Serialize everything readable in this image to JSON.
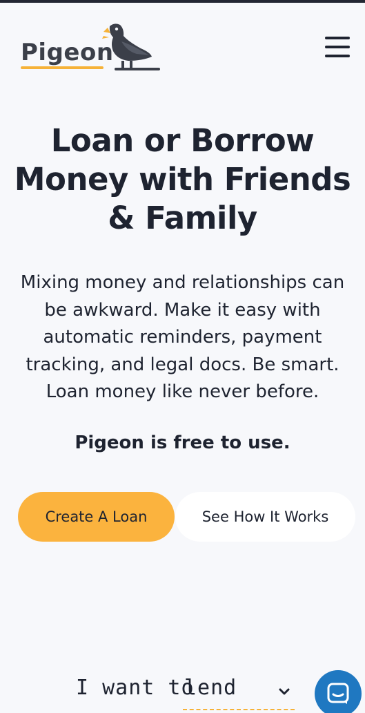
{
  "header": {
    "logo_text": "Pigeon",
    "brand_color": "#f6b238",
    "menu_icon": "hamburger-menu-icon"
  },
  "hero": {
    "title_lines": [
      "Loan or Borrow",
      "Money with Friends",
      "& Family"
    ],
    "description_lines": [
      "Mixing money and relationships can",
      "be awkward. Make it easy with",
      "automatic reminders, payment",
      "tracking, and legal docs. Be smart.",
      "Loan money like never before."
    ],
    "free_note": "Pigeon is free to use."
  },
  "actions": {
    "create_loan_label": "Create A Loan",
    "see_how_label": "See How It Works",
    "primary_color": "#fbb33e"
  },
  "intent": {
    "prefix": "I want to",
    "selected_value": "lend",
    "dropdown_icon": "chevron-down-icon"
  },
  "chat": {
    "icon": "chat-bubble-icon",
    "color": "#1f78c1"
  }
}
